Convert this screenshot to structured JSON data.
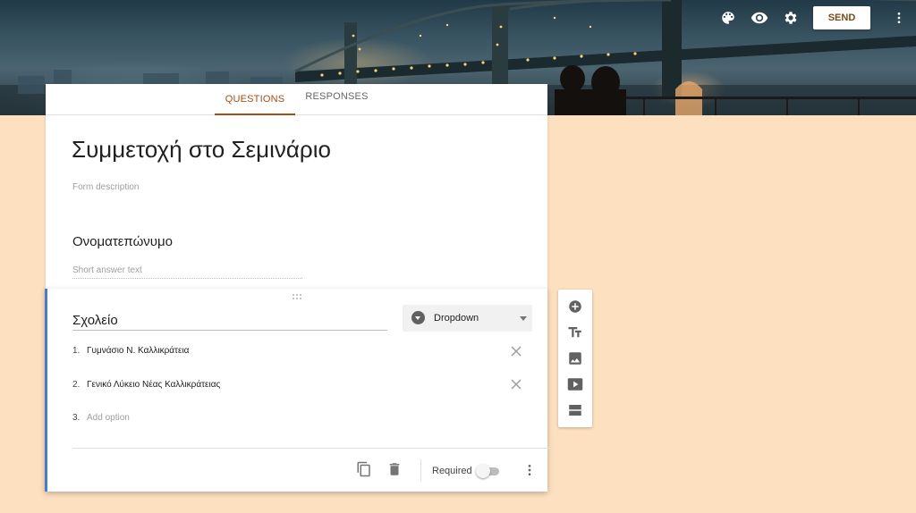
{
  "header": {
    "send_label": "SEND",
    "icons": [
      "palette-icon",
      "eye-icon",
      "gear-icon",
      "more-vert-icon"
    ]
  },
  "tabs": [
    {
      "label": "QUESTIONS",
      "active": true
    },
    {
      "label": "RESPONSES",
      "active": false
    }
  ],
  "form": {
    "title": "Συμμετοχή στο Σεμινάριο",
    "description_placeholder": "Form description"
  },
  "question1": {
    "title": "Ονοματεπώνυμο",
    "answer_placeholder": "Short answer text"
  },
  "question2": {
    "title": "Σχολείο",
    "type": "Dropdown",
    "options": [
      {
        "num": "1.",
        "label": "Γυμνάσιο Ν. Καλλικράτεια"
      },
      {
        "num": "2.",
        "label": "Γενικό Λύκειο Νέας Καλλικράτειας"
      }
    ],
    "add_option": {
      "num": "3.",
      "label": "Add option"
    },
    "required_label": "Required",
    "required": false
  },
  "side_toolbar": [
    "add-question-icon",
    "add-title-icon",
    "add-image-icon",
    "add-video-icon",
    "add-section-icon"
  ],
  "colors": {
    "accent": "#a14e17",
    "background": "#fde0c0",
    "active_border": "#4a7bd0"
  }
}
